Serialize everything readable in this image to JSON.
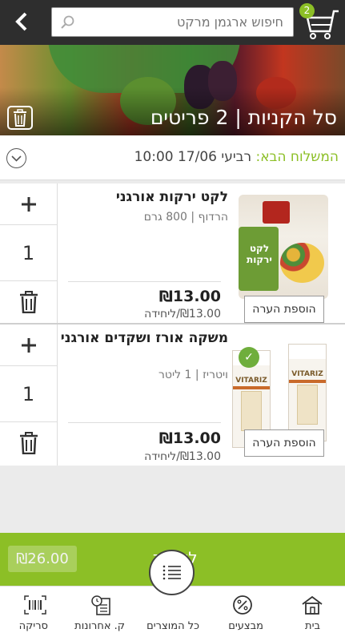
{
  "header": {
    "search_placeholder": "חיפוש ארגמן מרקט",
    "cart_count": "2"
  },
  "banner": {
    "title": "סל הקניות | 2 פריטים"
  },
  "delivery": {
    "label": "המשלוח הבא:",
    "value": "רביעי 17/06 10:00"
  },
  "items": [
    {
      "name": "לקט ירקות אורגני",
      "details": "הרדוף | 800 גרם",
      "quantity": "1",
      "price": "₪13.00",
      "unit_price": "₪13.00/ליחידה",
      "note_label": "הוספת הערה",
      "image_text": "לקט ירקות"
    },
    {
      "name": "משקה אורז ושקדים אורגני",
      "details": "ויטריז | 1 ליטר",
      "quantity": "1",
      "price": "₪13.00",
      "unit_price": "₪13.00/ליחידה",
      "note_label": "הוספת הערה",
      "image_text": "VITARIZ"
    }
  ],
  "checkout": {
    "label": "לקופה",
    "total": "₪26.00"
  },
  "bottom_nav": {
    "home": "בית",
    "deals": "מבצעים",
    "all_products": "כל המוצרים",
    "recent_purchases": "ק. אחרונות",
    "scan": "סריקה"
  },
  "colors": {
    "accent": "#8cbf26",
    "topbar": "#2e2e2e"
  },
  "icons": {
    "back": "chevron-left-icon",
    "search": "search-icon",
    "cart": "cart-icon",
    "trash": "trash-icon",
    "plus": "plus-icon",
    "chevron": "chevron-down-icon",
    "home": "home-icon",
    "deals": "percent-icon",
    "all_products": "list-icon",
    "recent": "receipt-icon",
    "scan": "barcode-icon"
  }
}
